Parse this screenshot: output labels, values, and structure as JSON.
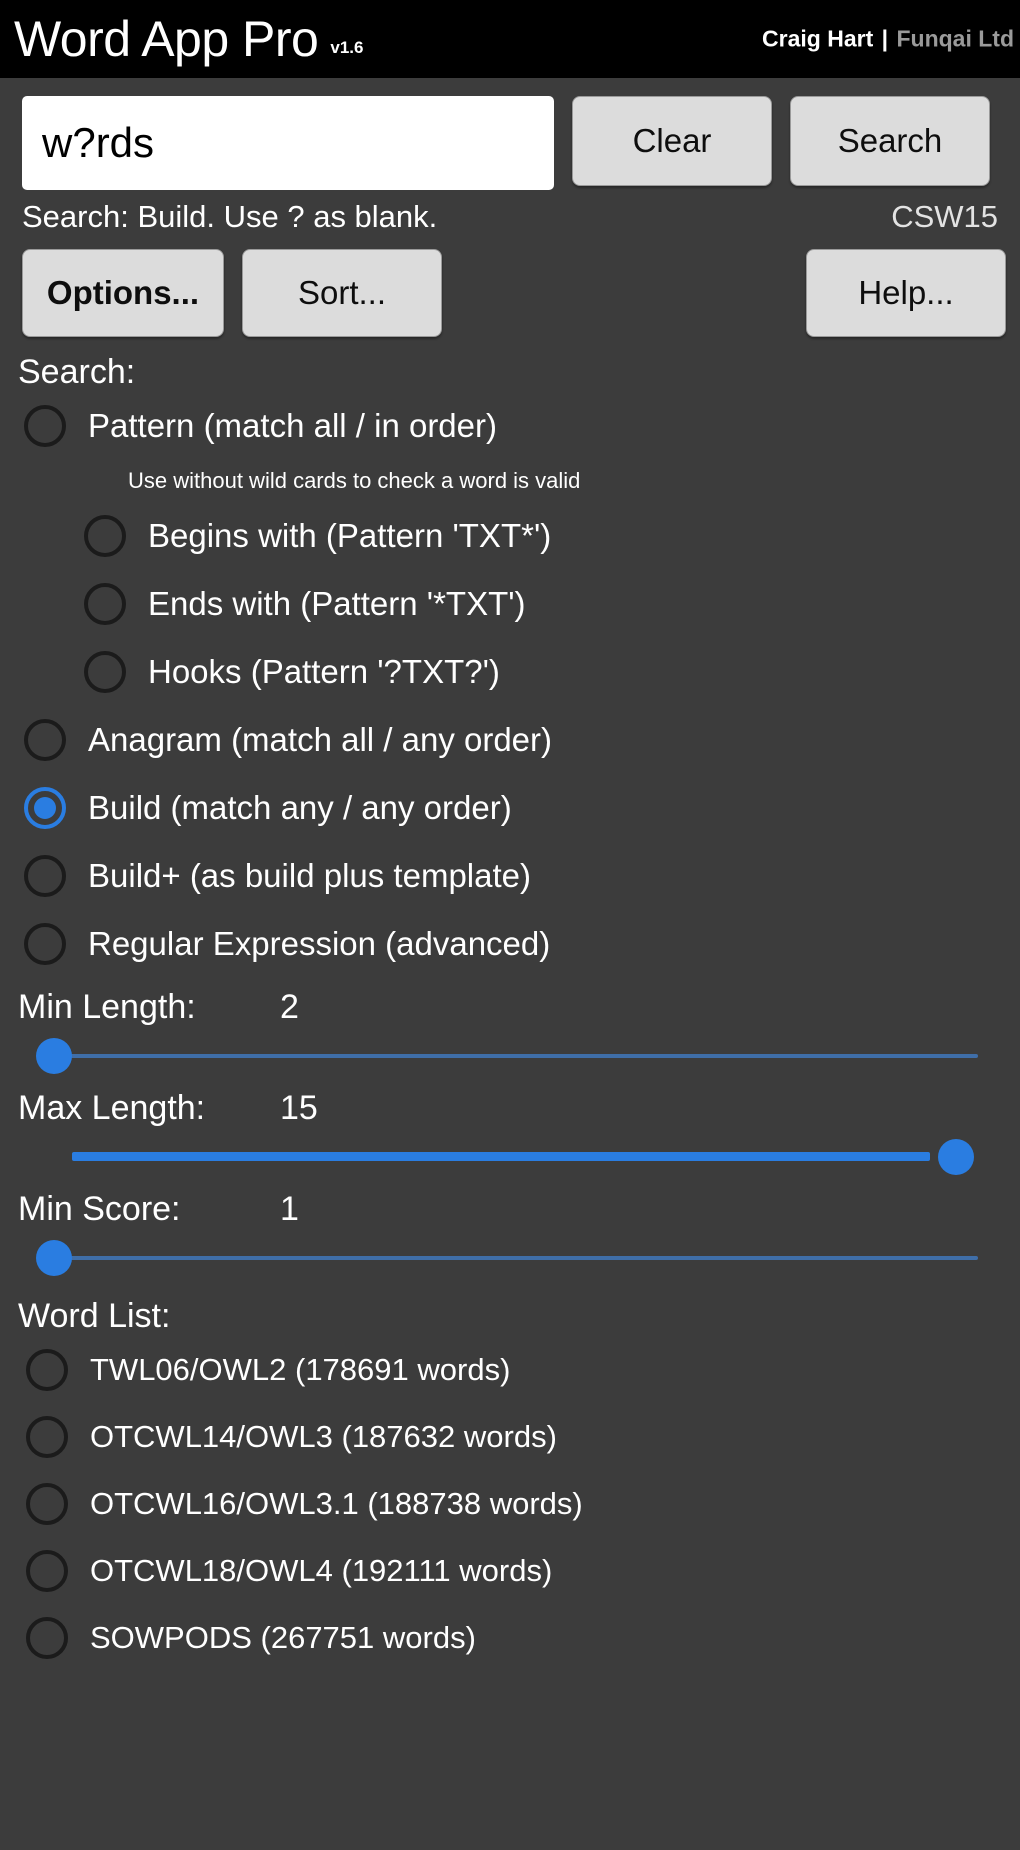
{
  "titlebar": {
    "app_name": "Word App Pro",
    "version": "v1.6",
    "author": "Craig Hart",
    "separator": "|",
    "company": "Funqai Ltd"
  },
  "search": {
    "value": "w?rds",
    "placeholder": "",
    "clear_label": "Clear",
    "search_label": "Search"
  },
  "status": {
    "left": "Search: Build. Use ? as blank.",
    "right": "CSW15"
  },
  "tools": {
    "options_label": "Options...",
    "sort_label": "Sort...",
    "help_label": "Help..."
  },
  "search_section": {
    "label": "Search:",
    "hint": "Use without wild cards to check a word is valid",
    "options": [
      {
        "label": "Pattern (match all / in order)",
        "checked": false,
        "indent": false
      },
      {
        "label": "Begins with (Pattern 'TXT*')",
        "checked": false,
        "indent": true
      },
      {
        "label": "Ends with (Pattern '*TXT')",
        "checked": false,
        "indent": true
      },
      {
        "label": "Hooks (Pattern '?TXT?')",
        "checked": false,
        "indent": true
      },
      {
        "label": "Anagram (match all / any order)",
        "checked": false,
        "indent": false
      },
      {
        "label": "Build (match any / any order)",
        "checked": true,
        "indent": false
      },
      {
        "label": "Build+ (as build plus template)",
        "checked": false,
        "indent": false
      },
      {
        "label": "Regular Expression (advanced)",
        "checked": false,
        "indent": false
      }
    ]
  },
  "sliders": [
    {
      "label": "Min Length:",
      "value": "2",
      "position": "left"
    },
    {
      "label": "Max Length:",
      "value": "15",
      "position": "right"
    },
    {
      "label": "Min Score:",
      "value": "1",
      "position": "left"
    }
  ],
  "word_list": {
    "label": "Word List:",
    "options": [
      {
        "label": "TWL06/OWL2 (178691 words)",
        "checked": false
      },
      {
        "label": "OTCWL14/OWL3 (187632 words)",
        "checked": false
      },
      {
        "label": "OTCWL16/OWL3.1 (188738 words)",
        "checked": false
      },
      {
        "label": "OTCWL18/OWL4 (192111 words)",
        "checked": false
      },
      {
        "label": "SOWPODS (267751 words)",
        "checked": false
      }
    ]
  },
  "colors": {
    "background": "#3c3c3c",
    "titlebar": "#000000",
    "accent": "#2a7de1",
    "button": "#dcdcdc",
    "text": "#ffffff"
  }
}
